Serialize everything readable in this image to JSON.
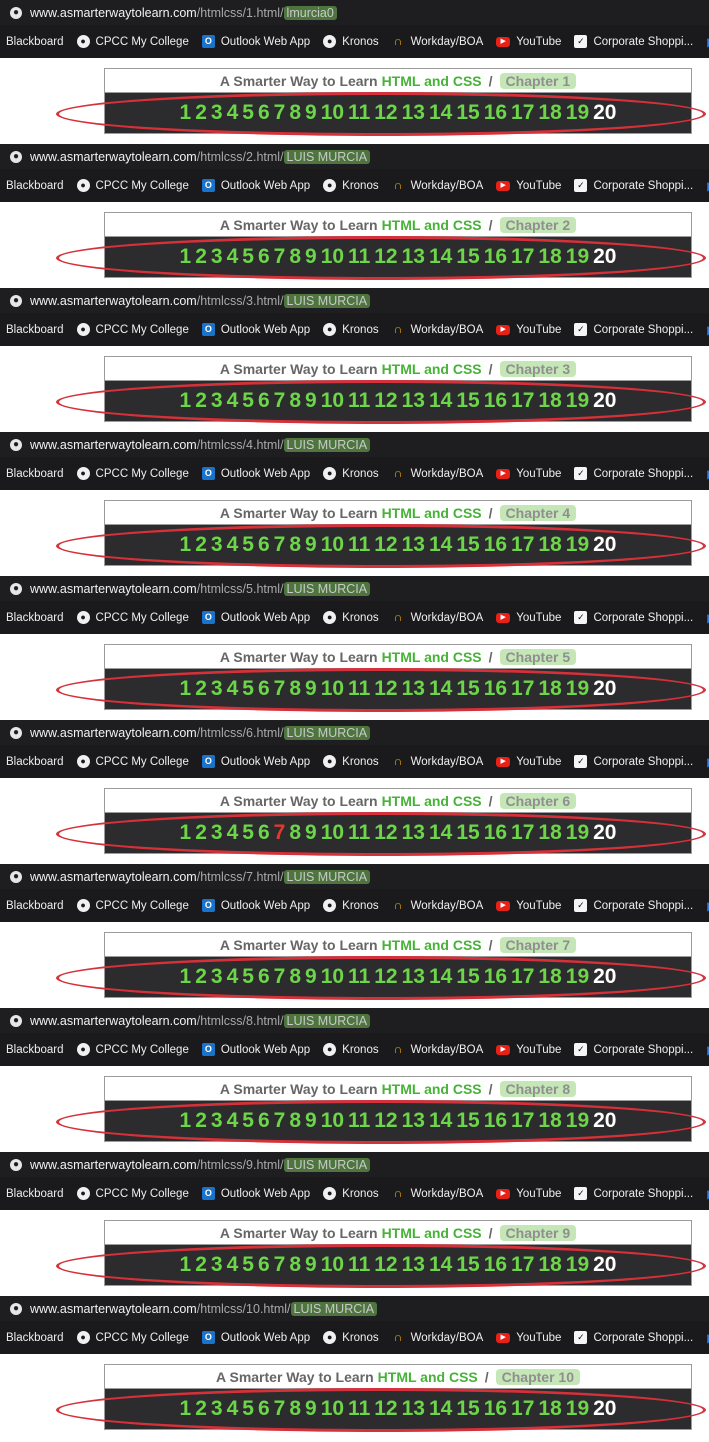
{
  "bookmarks": [
    {
      "label": "Blackboard",
      "icon": "none"
    },
    {
      "label": "CPCC My College",
      "icon": "globe-icon"
    },
    {
      "label": "Outlook Web App",
      "icon": "outlook-icon"
    },
    {
      "label": "Kronos",
      "icon": "globe-icon"
    },
    {
      "label": "Workday/BOA",
      "icon": "workday-icon"
    },
    {
      "label": "YouTube",
      "icon": "youtube-icon"
    },
    {
      "label": "Corporate Shoppi...",
      "icon": "check-icon"
    }
  ],
  "header": {
    "prefix": "A Smarter Way to Learn",
    "highlight": "HTML and CSS",
    "separator": "/"
  },
  "chapter_numbers": [
    "1",
    "2",
    "3",
    "4",
    "5",
    "6",
    "7",
    "8",
    "9",
    "10",
    "11",
    "12",
    "13",
    "14",
    "15",
    "16",
    "17",
    "18",
    "19",
    "20"
  ],
  "colors": {
    "number_green": "#6cd548",
    "number_last": "#ffffff",
    "number_active": "#e03a30",
    "annotation_red": "#d6303a",
    "name_highlight": "#78be5a"
  },
  "screenshots": [
    {
      "host": "www.asmarterwaytolearn.com",
      "path": "/htmlcss/1.html/",
      "user": "lmurcia0",
      "chapter": "Chapter 1",
      "active_number": null
    },
    {
      "host": "www.asmarterwaytolearn.com",
      "path": "/htmlcss/2.html/",
      "user": "LUIS MURCIA",
      "chapter": "Chapter 2",
      "active_number": null
    },
    {
      "host": "www.asmarterwaytolearn.com",
      "path": "/htmlcss/3.html/",
      "user": "LUIS MURCIA",
      "chapter": "Chapter 3",
      "active_number": null
    },
    {
      "host": "www.asmarterwaytolearn.com",
      "path": "/htmlcss/4.html/",
      "user": "LUIS MURCIA",
      "chapter": "Chapter 4",
      "active_number": null
    },
    {
      "host": "www.asmarterwaytolearn.com",
      "path": "/htmlcss/5.html/",
      "user": "LUIS MURCIA",
      "chapter": "Chapter 5",
      "active_number": null
    },
    {
      "host": "www.asmarterwaytolearn.com",
      "path": "/htmlcss/6.html/",
      "user": "LUIS MURCIA",
      "chapter": "Chapter 6",
      "active_number": "7"
    },
    {
      "host": "www.asmarterwaytolearn.com",
      "path": "/htmlcss/7.html/",
      "user": "LUIS MURCIA",
      "chapter": "Chapter 7",
      "active_number": null
    },
    {
      "host": "www.asmarterwaytolearn.com",
      "path": "/htmlcss/8.html/",
      "user": "LUIS MURCIA",
      "chapter": "Chapter 8",
      "active_number": null
    },
    {
      "host": "www.asmarterwaytolearn.com",
      "path": "/htmlcss/9.html/",
      "user": "LUIS MURCIA",
      "chapter": "Chapter 9",
      "active_number": null
    },
    {
      "host": "www.asmarterwaytolearn.com",
      "path": "/htmlcss/10.html/",
      "user": "LUIS MURCIA",
      "chapter": "Chapter 10",
      "active_number": null
    }
  ]
}
